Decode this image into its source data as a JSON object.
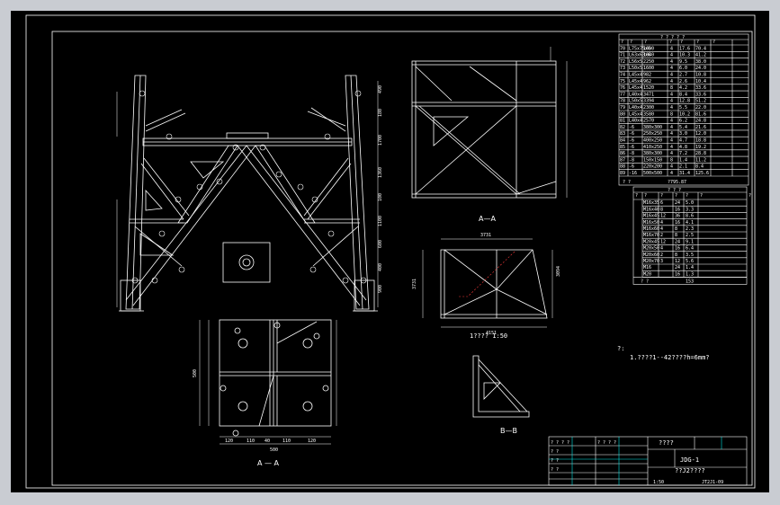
{
  "colors": {
    "background": "#000000",
    "line": "#ffffff",
    "frame": "#c9ccd2",
    "dim": "#00e5e5",
    "accent": "#ff3b3b"
  },
  "views": {
    "section_aa": "A—A",
    "section_bb": "B—B",
    "plan": "A — A",
    "detail_caption": "1????  1:50"
  },
  "notes": {
    "title": "?:",
    "line1": "1.????1--42????h=6mm?"
  },
  "dims": {
    "elevation": [
      "490",
      "180",
      "1700",
      "1360",
      "100",
      "1100",
      "600",
      "400",
      "900"
    ],
    "plan_width": "500",
    "plan_height": "500",
    "plan_bottom": [
      "120",
      "110",
      "40",
      "110",
      "120"
    ],
    "detail_top": "3731",
    "detail_bottom": "4151",
    "detail_left": "3731",
    "detail_right": "3094"
  },
  "bom_header": {
    "title": "? ? ? ? ?",
    "cols": [
      "?",
      "?",
      "?",
      "?",
      "?",
      "?",
      "?"
    ]
  },
  "bom_rows": [
    [
      "70",
      "L75x75x6",
      "1690",
      "4",
      "17.6",
      "70.4"
    ],
    [
      "71",
      "L63x63x6",
      "1840",
      "4",
      "10.3",
      "41.2"
    ],
    [
      "72",
      "L56x5",
      "2250",
      "4",
      "9.5",
      "38.0"
    ],
    [
      "73",
      "L50x5",
      "1600",
      "4",
      "6.0",
      "24.0"
    ],
    [
      "74",
      "L45x4",
      "982",
      "4",
      "2.7",
      "10.8"
    ],
    [
      "75",
      "L45x4",
      "962",
      "4",
      "2.6",
      "10.4"
    ],
    [
      "76",
      "L45x4",
      "1520",
      "8",
      "4.2",
      "33.6"
    ],
    [
      "77",
      "L40x4",
      "3471",
      "4",
      "8.4",
      "33.6"
    ],
    [
      "78",
      "L50x5",
      "3394",
      "4",
      "12.8",
      "51.2"
    ],
    [
      "79",
      "L40x4",
      "2300",
      "4",
      "5.5",
      "22.0"
    ],
    [
      "80",
      "L45x4",
      "3580",
      "8",
      "10.2",
      "81.6"
    ],
    [
      "81",
      "L40x4",
      "2570",
      "4",
      "6.2",
      "24.8"
    ],
    [
      "82",
      "-6",
      "380x300",
      "4",
      "5.4",
      "21.6"
    ],
    [
      "83",
      "-6",
      "250x250",
      "4",
      "3.0",
      "12.0"
    ],
    [
      "84",
      "-6",
      "400x250",
      "4",
      "4.7",
      "18.8"
    ],
    [
      "85",
      "-6",
      "410x250",
      "4",
      "4.8",
      "19.2"
    ],
    [
      "86",
      "-8",
      "380x300",
      "4",
      "7.2",
      "28.8"
    ],
    [
      "87",
      "-8",
      "150x150",
      "8",
      "1.4",
      "11.2"
    ],
    [
      "88",
      "-6",
      "220x200",
      "4",
      "2.1",
      "8.4"
    ],
    [
      "89",
      "-16",
      "500x500",
      "4",
      "31.4",
      "125.6"
    ]
  ],
  "bom_total": {
    "label": "? ?",
    "value": "?795.87"
  },
  "bolt_header": {
    "title": "? ? ?",
    "cols": [
      "?",
      "?",
      "?",
      "?",
      "?",
      "?",
      "?"
    ]
  },
  "bolt_rows": [
    [
      "M16x35",
      "6",
      "24",
      "5.0"
    ],
    [
      "M16x40",
      "8",
      "16",
      "3.3"
    ],
    [
      "M16x45",
      "12",
      "36",
      "8.6"
    ],
    [
      "M16x50",
      "4",
      "16",
      "4.1"
    ],
    [
      "M16x60",
      "4",
      "8",
      "2.3"
    ],
    [
      "M16x70",
      "2",
      "8",
      "2.5"
    ],
    [
      "M20x45",
      "12",
      "24",
      "9.1"
    ],
    [
      "M20x50",
      "4",
      "16",
      "6.4"
    ],
    [
      "M20x60",
      "2",
      "8",
      "3.5"
    ],
    [
      "M20x70",
      "3",
      "12",
      "5.6"
    ],
    [
      "M16",
      "",
      "24",
      "1.4"
    ],
    [
      "M20",
      "",
      "16",
      "1.3"
    ]
  ],
  "bolt_total": {
    "label": "? ?",
    "value": "153"
  },
  "title_block": {
    "project": "????",
    "drawing": "JDG-1",
    "subtitle": "??J2????",
    "scale": "1:50",
    "number": "JT2J1-09",
    "rows": [
      "? ? ? ?",
      "? ?",
      "? ?",
      "? ?"
    ],
    "sign": "? ? ? ?"
  }
}
